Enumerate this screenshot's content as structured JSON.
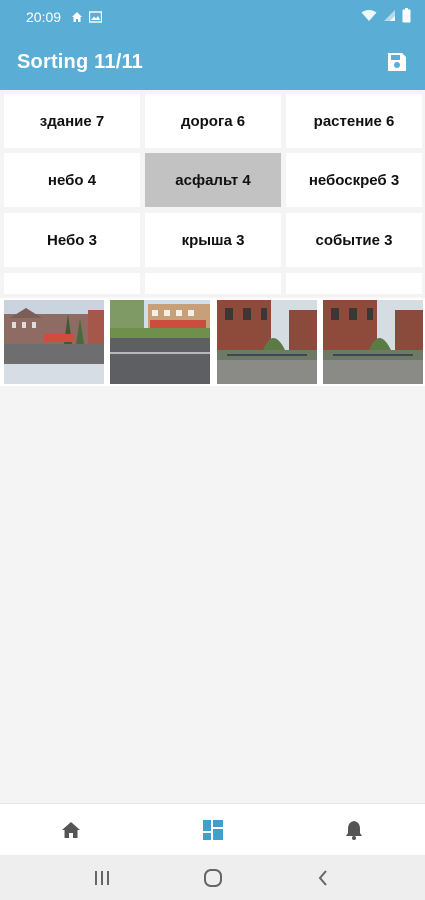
{
  "status_bar": {
    "time": "20:09",
    "icons": [
      "home-icon",
      "image-icon",
      "wifi-icon",
      "signal-icon",
      "battery-icon"
    ]
  },
  "app_bar": {
    "title": "Sorting 11/11",
    "save_icon": "save-icon",
    "color": "#5aaed6"
  },
  "tags": [
    {
      "label": "здание 7",
      "selected": false
    },
    {
      "label": "дорога 6",
      "selected": false
    },
    {
      "label": "растение 6",
      "selected": false
    },
    {
      "label": "небо 4",
      "selected": false
    },
    {
      "label": "асфальт 4",
      "selected": true
    },
    {
      "label": "небоскреб 3",
      "selected": false
    },
    {
      "label": "Небо 3",
      "selected": false
    },
    {
      "label": "крыша 3",
      "selected": false
    },
    {
      "label": "событие 3",
      "selected": false
    },
    {
      "label": "",
      "selected": false
    },
    {
      "label": "",
      "selected": false
    },
    {
      "label": "",
      "selected": false
    }
  ],
  "photos": [
    {
      "name": "street-square-photo"
    },
    {
      "name": "road-buildings-photo"
    },
    {
      "name": "brick-building-yard-photo"
    },
    {
      "name": "brick-building-yard-photo-2"
    }
  ],
  "bottom_nav": {
    "items": [
      {
        "icon": "home-icon",
        "active": false
      },
      {
        "icon": "dashboard-icon",
        "active": true
      },
      {
        "icon": "bell-icon",
        "active": false
      }
    ],
    "active_color": "#3fa0d0",
    "inactive_color": "#555555"
  },
  "system_nav": {
    "items": [
      "recent-apps-icon",
      "home-circle-icon",
      "back-icon"
    ]
  }
}
